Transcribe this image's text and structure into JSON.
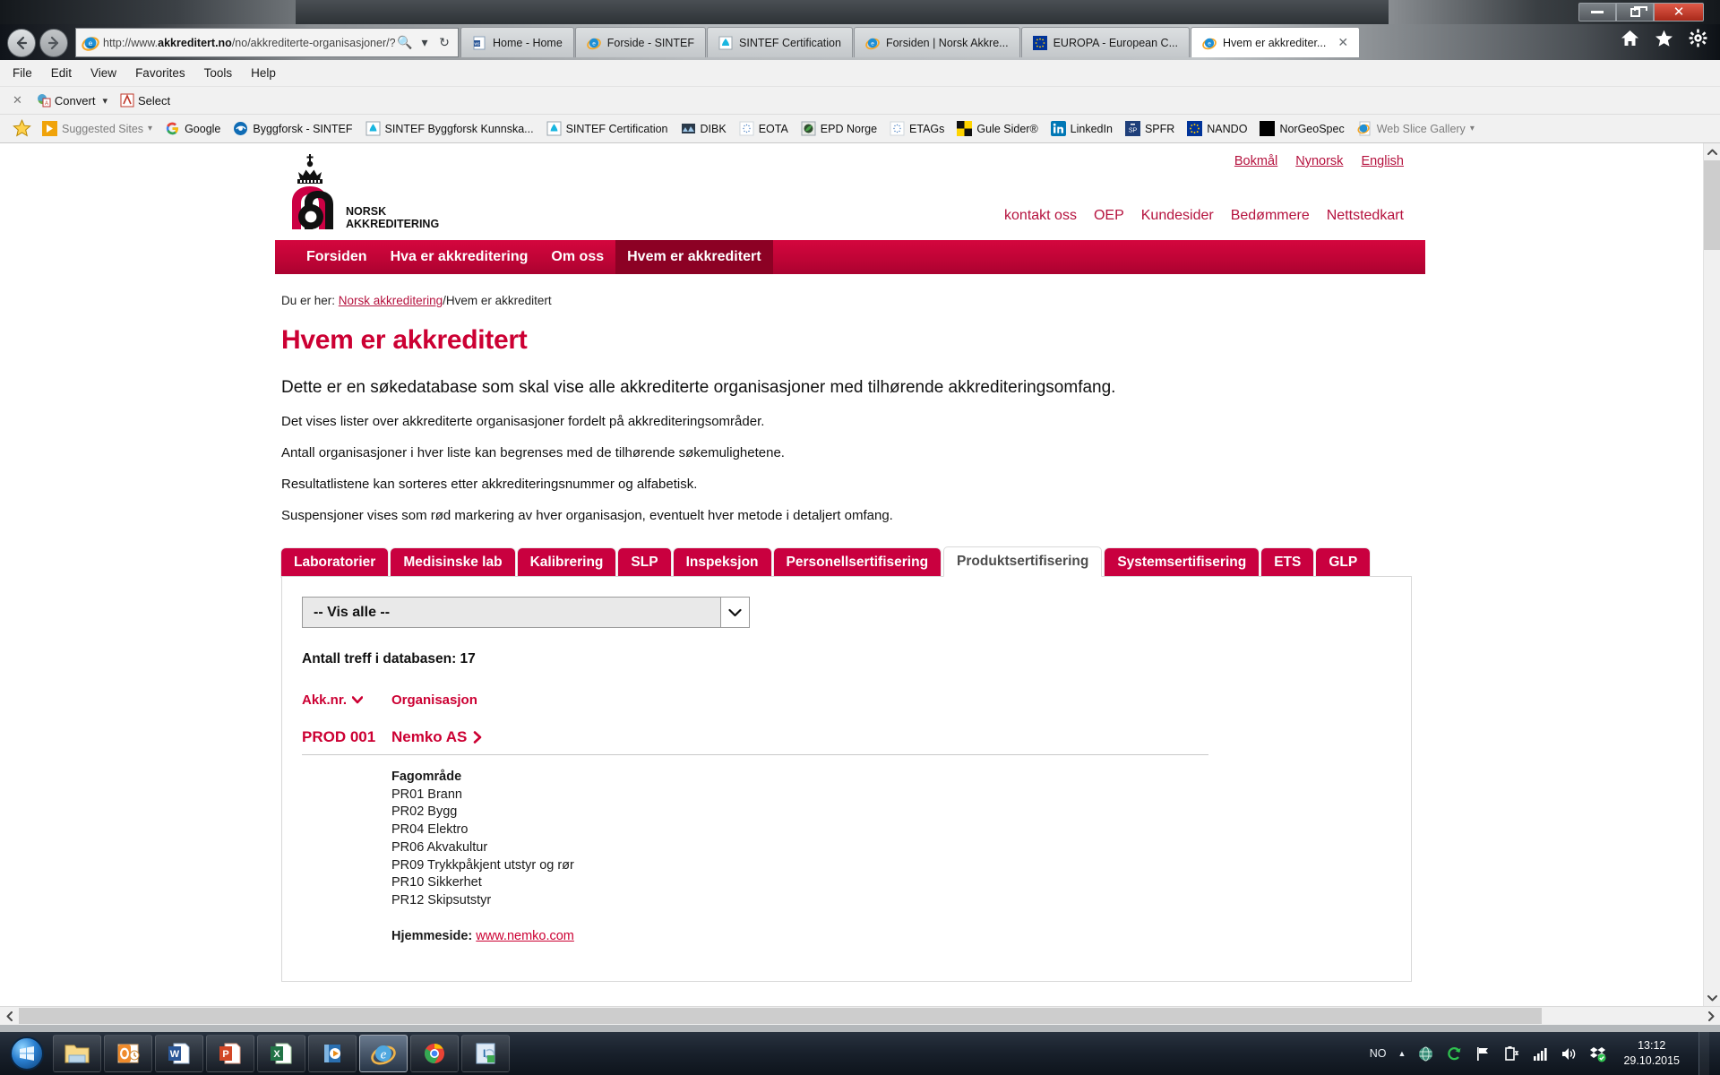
{
  "window": {
    "minimize_label": "Minimize",
    "maximize_label": "Maximize",
    "close_label": "Close"
  },
  "browser": {
    "back_glyph": "←",
    "forward_glyph": "→",
    "address_prefix": "http://www.",
    "address_domain": "akkreditert.no",
    "address_path": "/no/akkrediterte-organisasjoner/?scc",
    "search_glyph": "🔍",
    "dropdown_glyph": "▾",
    "refresh_glyph": "↻",
    "tabs": [
      {
        "label": "Home - Home",
        "icon": "word-doc-icon",
        "active": false
      },
      {
        "label": "Forside - SINTEF",
        "icon": "ie-icon",
        "active": false
      },
      {
        "label": "SINTEF Certification",
        "icon": "sintef-icon",
        "active": false
      },
      {
        "label": "Forsiden | Norsk Akkre...",
        "icon": "ie-icon",
        "active": false
      },
      {
        "label": "EUROPA - European C...",
        "icon": "eu-icon",
        "active": false
      },
      {
        "label": "Hvem er akkrediter...",
        "icon": "ie-icon",
        "active": true,
        "close_glyph": "✕"
      }
    ],
    "toolbar_icons": [
      "home-icon",
      "favorites-star-icon",
      "settings-gear-icon"
    ]
  },
  "menubar": {
    "items": [
      "File",
      "Edit",
      "View",
      "Favorites",
      "Tools",
      "Help"
    ]
  },
  "commandbar": {
    "close_glyph": "✕",
    "convert_label": "Convert",
    "convert_caret": "▾",
    "select_label": "Select"
  },
  "favorites": {
    "star_icon": "favorites-star-icon",
    "items": [
      {
        "label": "Suggested Sites",
        "icon": "suggested-sites-icon",
        "caret": "▾",
        "muted": true
      },
      {
        "label": "Google",
        "icon": "google-icon"
      },
      {
        "label": "Byggforsk - SINTEF",
        "icon": "byggforsk-icon"
      },
      {
        "label": "SINTEF Byggforsk Kunnska...",
        "icon": "sintef-icon"
      },
      {
        "label": "SINTEF Certification",
        "icon": "sintef-icon"
      },
      {
        "label": "DIBK",
        "icon": "dibk-icon"
      },
      {
        "label": "EOTA",
        "icon": "eota-icon"
      },
      {
        "label": "EPD Norge",
        "icon": "epd-icon"
      },
      {
        "label": "ETAGs",
        "icon": "etags-icon"
      },
      {
        "label": "Gule Sider®",
        "icon": "gulesider-icon"
      },
      {
        "label": "LinkedIn",
        "icon": "linkedin-icon"
      },
      {
        "label": "SPFR",
        "icon": "spfr-icon"
      },
      {
        "label": "NANDO",
        "icon": "eu-icon"
      },
      {
        "label": "NorGeoSpec",
        "icon": "norgeospec-icon"
      }
    ],
    "webslice_label": "Web Slice Gallery",
    "webslice_caret": "▾",
    "webslice_icon": "ie-feed-icon"
  },
  "site": {
    "logo_alt": "NORSK AKKREDITERING",
    "logo_line1": "NORSK",
    "logo_line2": "AKKREDITERING",
    "brand_color": "#cc0033",
    "languages": [
      "Bokmål",
      "Nynorsk",
      "English"
    ],
    "util_nav": [
      "kontakt oss",
      "OEP",
      "Kundesider",
      "Bedømmere",
      "Nettstedkart"
    ],
    "main_nav": [
      {
        "label": "Forsiden",
        "active": false
      },
      {
        "label": "Hva er akkreditering",
        "active": false
      },
      {
        "label": "Om oss",
        "active": false
      },
      {
        "label": "Hvem er akkreditert",
        "active": true
      }
    ]
  },
  "page": {
    "breadcrumb_prefix": "Du er her:",
    "breadcrumb_link": "Norsk akkreditering",
    "breadcrumb_current": "/Hvem er akkreditert",
    "title": "Hvem er akkreditert",
    "lead": "Dette er en søkedatabase som skal vise alle akkrediterte organisasjoner med tilhørende akkrediteringsomfang.",
    "paragraphs": [
      "Det vises lister over akkrediterte organisasjoner fordelt på akkrediteringsområder.",
      "Antall organisasjoner i hver liste kan begrenses med de tilhørende søkemulighetene.",
      "Resultatlistene kan sorteres etter akkrediteringsnummer og alfabetisk.",
      "Suspensjoner vises som rød markering av hver organisasjon, eventuelt hver metode i detaljert omfang."
    ]
  },
  "database": {
    "tabs": [
      {
        "label": "Laboratorier",
        "active": false
      },
      {
        "label": "Medisinske lab",
        "active": false
      },
      {
        "label": "Kalibrering",
        "active": false
      },
      {
        "label": "SLP",
        "active": false
      },
      {
        "label": "Inspeksjon",
        "active": false
      },
      {
        "label": "Personellsertifisering",
        "active": false
      },
      {
        "label": "Produktsertifisering",
        "active": true
      },
      {
        "label": "Systemsertifisering",
        "active": false
      },
      {
        "label": "ETS",
        "active": false
      },
      {
        "label": "GLP",
        "active": false
      }
    ],
    "filter_select": {
      "value": "-- Vis alle --",
      "caret": "⌄"
    },
    "hits_label": "Antall treff i databasen: 17",
    "columns": {
      "akk_nr": "Akk.nr.",
      "sort_glyph": "❯",
      "organisasjon": "Organisasjon"
    },
    "rows": [
      {
        "akk_nr": "PROD 001",
        "organisasjon": "Nemko AS",
        "expand_glyph": "❯",
        "detail": {
          "heading": "Fagområde",
          "areas": [
            "PR01 Brann",
            "PR02 Bygg",
            "PR04 Elektro",
            "PR06 Akvakultur",
            "PR09 Trykkpåkjent utstyr og rør",
            "PR10 Sikkerhet",
            "PR12 Skipsutstyr"
          ],
          "homepage_label": "Hjemmeside:",
          "homepage_url": "www.nemko.com"
        }
      }
    ]
  },
  "scrollbars": {
    "up_glyph": "∧",
    "down_glyph": "∨",
    "left_glyph": "‹",
    "right_glyph": "›"
  },
  "taskbar": {
    "start_label": "Start",
    "buttons": [
      {
        "name": "windows-explorer",
        "label": "Windows Explorer",
        "active": false
      },
      {
        "name": "outlook",
        "label": "Microsoft Outlook",
        "active": false
      },
      {
        "name": "word",
        "label": "Microsoft Word",
        "active": false
      },
      {
        "name": "powerpoint",
        "label": "Microsoft PowerPoint",
        "active": false
      },
      {
        "name": "excel",
        "label": "Microsoft Excel",
        "active": false
      },
      {
        "name": "media-player",
        "label": "Windows Media Player",
        "active": false
      },
      {
        "name": "internet-explorer",
        "label": "Internet Explorer",
        "active": true
      },
      {
        "name": "chrome",
        "label": "Google Chrome",
        "active": false
      },
      {
        "name": "lync",
        "label": "Microsoft Lync",
        "active": false
      }
    ],
    "tray": {
      "language": "NO",
      "expand_glyph": "▲",
      "icons": [
        "network-globe-icon",
        "sync-icon",
        "flag-icon",
        "battery-icon",
        "signal-icon",
        "volume-icon",
        "dropbox-icon"
      ],
      "time": "13:12",
      "date": "29.10.2015"
    }
  }
}
